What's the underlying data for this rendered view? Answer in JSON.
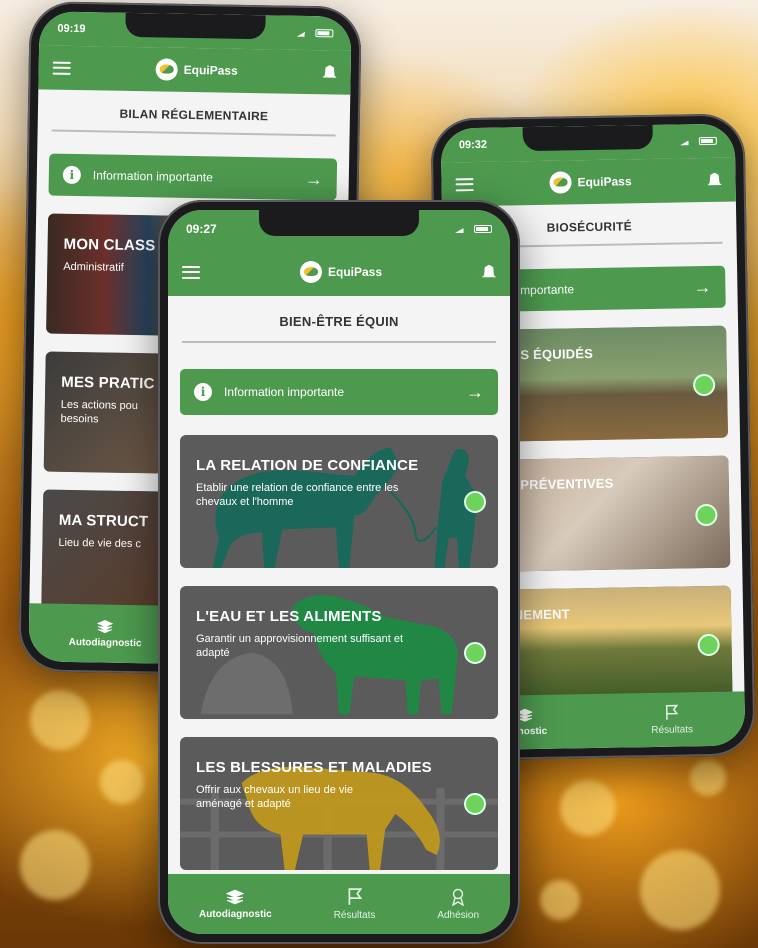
{
  "app": {
    "name": "EquiPass"
  },
  "phones": {
    "left": {
      "time": "09:19",
      "section_title": "BILAN RÉGLEMENTAIRE",
      "info_button": "Information importante",
      "cards": [
        {
          "title": "MON CLASS",
          "description": "Administratif"
        },
        {
          "title": "MES PRATIC",
          "description": "Les actions pou besoins"
        },
        {
          "title": "MA STRUCT",
          "description": "Lieu de vie des c"
        }
      ],
      "tabs": [
        "Autodiagnostic"
      ]
    },
    "right": {
      "time": "09:32",
      "section_title": "BIOSÉCURITÉ",
      "info_button": "nformation importante",
      "cards": [
        {
          "title": "ESTION DES ÉQUIDÉS",
          "description": ""
        },
        {
          "title": "MESURES PRÉVENTIVES",
          "description": ""
        },
        {
          "title": "ENVIRONNEMENT",
          "description": ""
        }
      ],
      "tabs": [
        "iagnostic",
        "Résultats"
      ]
    },
    "center": {
      "time": "09:27",
      "section_title": "BIEN-ÊTRE ÉQUIN",
      "info_button": "Information importante",
      "cards": [
        {
          "title": "LA RELATION DE CONFIANCE",
          "description": "Etablir une relation de confiance entre les chevaux et l'homme"
        },
        {
          "title": "L'EAU ET LES ALIMENTS",
          "description": "Garantir un approvisionnement suffisant et adapté"
        },
        {
          "title": "LES BLESSURES ET MALADIES",
          "description": "Offrir aux chevaux un lieu de vie aménagé et adapté"
        }
      ],
      "tabs": [
        "Autodiagnostic",
        "Résultats",
        "Adhésion"
      ]
    }
  },
  "colors": {
    "primary_green": "#4d9a4f",
    "status_dot": "#6ed35a",
    "card_gray": "#5b5b5b",
    "silhouette_teal": "#0e6b5a",
    "silhouette_green": "#1f8a43",
    "silhouette_gold": "#c49a1a"
  },
  "icons": [
    "menu-icon",
    "equipass-logo",
    "bell-icon",
    "info-icon",
    "arrow-right-icon",
    "stack-icon",
    "flag-icon",
    "horse-badge-icon",
    "check-dot-icon"
  ]
}
